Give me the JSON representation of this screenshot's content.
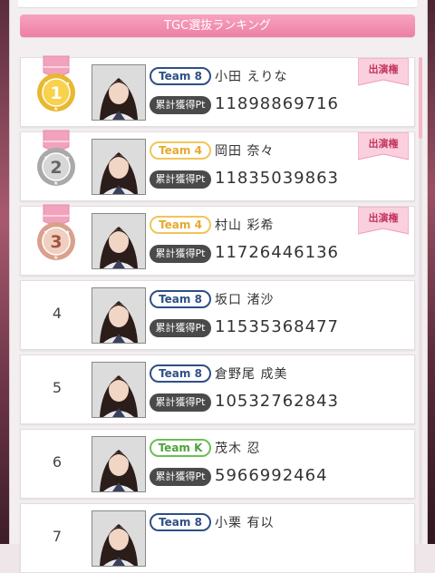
{
  "header": {
    "title": "TGC選抜ランキング"
  },
  "badge_label": "出演権",
  "pt_label": "累計獲得Pt",
  "colors": {
    "accent": "#ee7fa4",
    "team8": "#2f4f86",
    "team4": "#e6a92e",
    "teamK": "#4ea23a"
  },
  "ranking": [
    {
      "rank": "1",
      "team": "Team 8",
      "team_style": "t8",
      "name": "小田 えりな",
      "points": "11898869716",
      "medal": "gold",
      "badge": true
    },
    {
      "rank": "2",
      "team": "Team 4",
      "team_style": "t4",
      "name": "岡田 奈々",
      "points": "11835039863",
      "medal": "silver",
      "badge": true
    },
    {
      "rank": "3",
      "team": "Team 4",
      "team_style": "t4",
      "name": "村山 彩希",
      "points": "11726446136",
      "medal": "bronze",
      "badge": true
    },
    {
      "rank": "4",
      "team": "Team 8",
      "team_style": "t8",
      "name": "坂口 渚沙",
      "points": "11535368477",
      "medal": "",
      "badge": false
    },
    {
      "rank": "5",
      "team": "Team 8",
      "team_style": "t8",
      "name": "倉野尾 成美",
      "points": "10532762843",
      "medal": "",
      "badge": false
    },
    {
      "rank": "6",
      "team": "Team K",
      "team_style": "tk",
      "name": "茂木 忍",
      "points": "5966992464",
      "medal": "",
      "badge": false
    },
    {
      "rank": "7",
      "team": "Team 8",
      "team_style": "t8",
      "name": "小栗 有以",
      "points": "",
      "medal": "",
      "badge": false
    }
  ]
}
